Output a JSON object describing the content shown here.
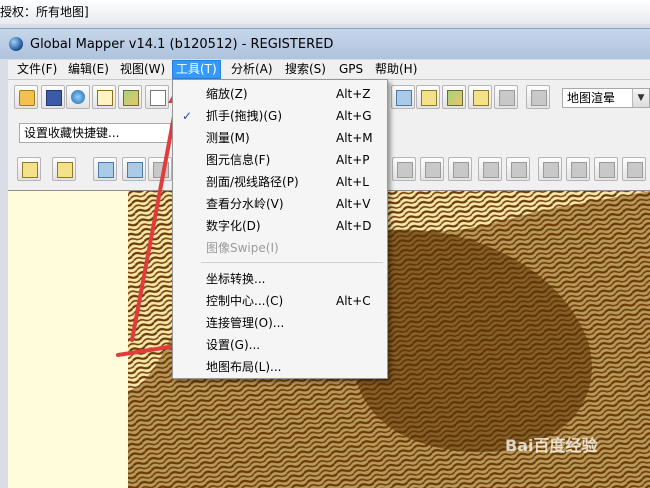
{
  "caption": "授权：所有地图]",
  "window": {
    "title": "Global Mapper v14.1 (b120512) - REGISTERED"
  },
  "menu_bar": {
    "items": [
      "文件(F)",
      "编辑(E)",
      "视图(W)",
      "工具(T)",
      "分析(A)",
      "搜索(S)",
      "GPS",
      "帮助(H)"
    ],
    "active": "工具(T)"
  },
  "toolbar": {
    "shortcut_select": "设置收藏快捷键...",
    "render_select": "地图渲晕"
  },
  "tools_menu": {
    "items": [
      {
        "label": "缩放(Z)",
        "shortcut": "Alt+Z",
        "enabled": true,
        "checked": false
      },
      {
        "label": "抓手(拖拽)(G)",
        "shortcut": "Alt+G",
        "enabled": true,
        "checked": true
      },
      {
        "label": "测量(M)",
        "shortcut": "Alt+M",
        "enabled": true,
        "checked": false
      },
      {
        "label": "图元信息(F)",
        "shortcut": "Alt+P",
        "enabled": true,
        "checked": false
      },
      {
        "label": "剖面/视线路径(P)",
        "shortcut": "Alt+L",
        "enabled": true,
        "checked": false
      },
      {
        "label": "查看分水岭(V)",
        "shortcut": "Alt+V",
        "enabled": true,
        "checked": false
      },
      {
        "label": "数字化(D)",
        "shortcut": "Alt+D",
        "enabled": true,
        "checked": false
      },
      {
        "label": "图像Swipe(I)",
        "shortcut": "",
        "enabled": false,
        "checked": false
      },
      {
        "label": "坐标转换...",
        "shortcut": "",
        "enabled": true,
        "checked": false
      },
      {
        "label": "控制中心...(C)",
        "shortcut": "Alt+C",
        "enabled": true,
        "checked": false
      },
      {
        "label": "连接管理(O)...",
        "shortcut": "",
        "enabled": true,
        "checked": false
      },
      {
        "label": "设置(G)...",
        "shortcut": "",
        "enabled": true,
        "checked": false
      },
      {
        "label": "地图布局(L)...",
        "shortcut": "",
        "enabled": true,
        "checked": false
      }
    ],
    "check_glyph": "✓"
  },
  "watermark": "Bai百度经验",
  "colors": {
    "terrain": "#6b3a00",
    "terrain_light": "#f6e7b0",
    "map_bg": "#fffcdc",
    "menu_highlight": "#3399ff",
    "arrow": "#e23b3b"
  }
}
